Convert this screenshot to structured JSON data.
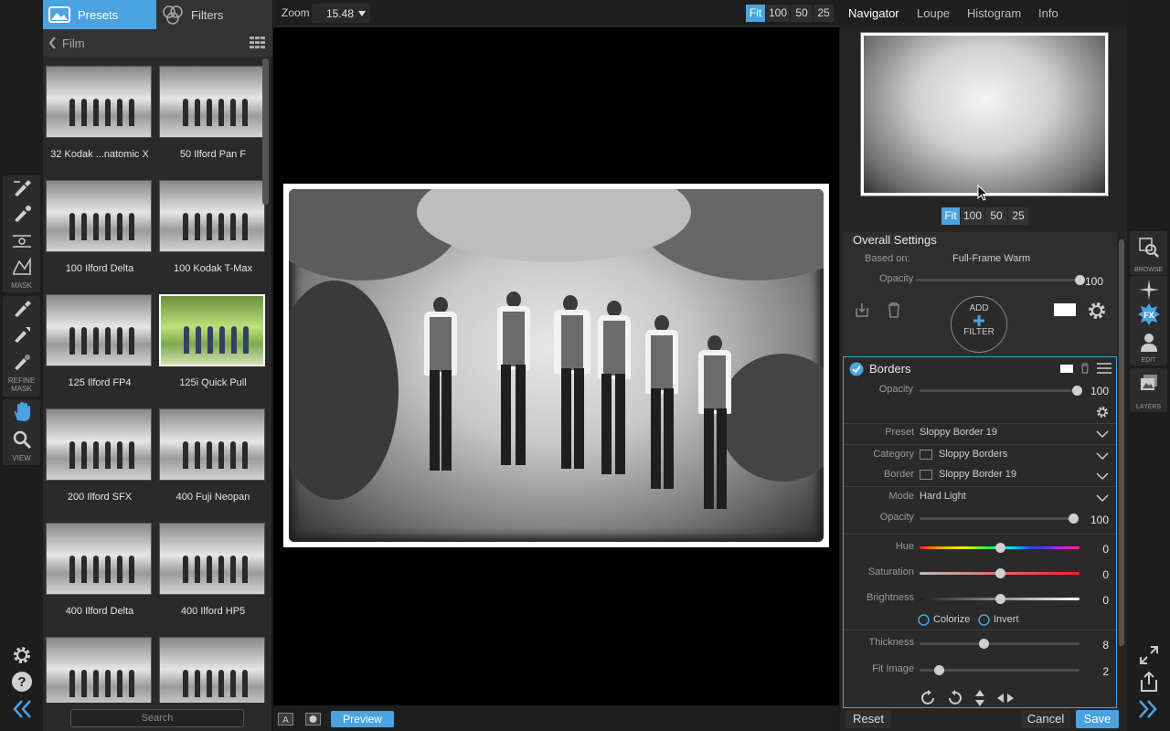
{
  "left_tools": {
    "mask_caption": "MASK",
    "refine_caption": "REFINE\nMASK",
    "view_caption": "VIEW"
  },
  "presets_panel": {
    "tab_presets": "Presets",
    "tab_filters": "Filters",
    "breadcrumb": "Film",
    "search_placeholder": "Search",
    "items": [
      {
        "label": "32 Kodak ...natomic X",
        "color": false
      },
      {
        "label": "50 Ilford Pan F",
        "color": false
      },
      {
        "label": "100 Ilford Delta",
        "color": false
      },
      {
        "label": "100 Kodak T-Max",
        "color": false
      },
      {
        "label": "125 Ilford FP4",
        "color": false
      },
      {
        "label": "125i Quick Pull",
        "color": true
      },
      {
        "label": "200 Ilford SFX",
        "color": false
      },
      {
        "label": "400 Fuji Neopan",
        "color": false
      },
      {
        "label": "400 Ilford Delta",
        "color": false
      },
      {
        "label": "400 Ilford HP5",
        "color": false
      },
      {
        "label": "",
        "color": false
      },
      {
        "label": "",
        "color": false
      }
    ]
  },
  "toolbar": {
    "zoom_label": "Zoom",
    "zoom_value": "15.48",
    "fit": "Fit",
    "z100": "100",
    "z50": "50",
    "z25": "25"
  },
  "bottom": {
    "preview": "Preview"
  },
  "right_panel": {
    "tabs": [
      "Navigator",
      "Loupe",
      "Histogram",
      "Info"
    ],
    "nav_fit": "Fit",
    "nav_100": "100",
    "nav_50": "50",
    "nav_25": "25",
    "overall": {
      "title": "Overall Settings",
      "based_on_label": "Based on:",
      "based_on_value": "Full-Frame Warm",
      "opacity_label": "Opacity",
      "opacity_value": "100",
      "add_label": "ADD",
      "filter_label": "FILTER"
    },
    "borders": {
      "title": "Borders",
      "opacity_label": "Opacity",
      "opacity_value": "100",
      "preset_label": "Preset",
      "preset_value": "Sloppy Border 19",
      "category_label": "Category",
      "category_value": "Sloppy Borders",
      "border_label": "Border",
      "border_value": "Sloppy Border 19",
      "mode_label": "Mode",
      "mode_value": "Hard Light",
      "opacity2_label": "Opacity",
      "opacity2_value": "100",
      "hue_label": "Hue",
      "hue_value": "0",
      "saturation_label": "Saturation",
      "saturation_value": "0",
      "brightness_label": "Brightness",
      "brightness_value": "0",
      "colorize_label": "Colorize",
      "invert_label": "Invert",
      "thickness_label": "Thickness",
      "thickness_value": "8",
      "fitimage_label": "Fit Image",
      "fitimage_value": "2"
    },
    "reset": "Reset",
    "cancel": "Cancel",
    "save": "Save"
  },
  "right_strip": {
    "browse": "BROWSE",
    "fx": "FX",
    "edit": "EDIT",
    "layers": "LAYERS"
  },
  "colors": {
    "accent": "#4aa3e0"
  }
}
